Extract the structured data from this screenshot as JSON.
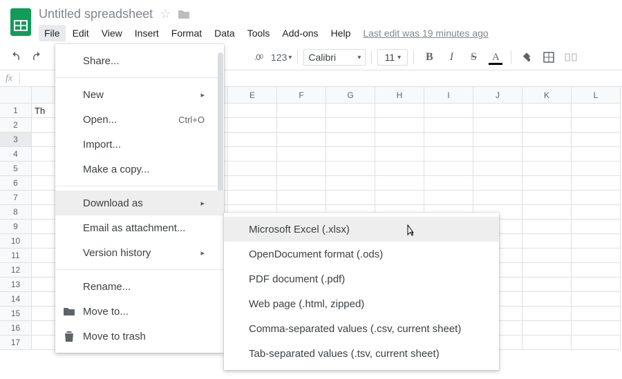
{
  "header": {
    "doc_title": "Untitled spreadsheet",
    "last_edit": "Last edit was 19 minutes ago",
    "menubar": [
      "File",
      "Edit",
      "View",
      "Insert",
      "Format",
      "Data",
      "Tools",
      "Add-ons",
      "Help"
    ],
    "open_menu": "File"
  },
  "toolbar": {
    "decimal_btn": ".0",
    "rounding_btn": ".00",
    "format_more": "123",
    "font_name": "Calibri",
    "font_size": "11",
    "bold": "B",
    "italic": "I",
    "strike": "S",
    "textcolor": "A"
  },
  "fx": {
    "label": "fx"
  },
  "grid": {
    "columns": [
      "",
      "",
      "",
      "",
      "E",
      "F",
      "G",
      "H",
      "I",
      "J",
      "K",
      "L"
    ],
    "row_count": 17,
    "selected_row": 3,
    "a1_value": "Th"
  },
  "file_menu": {
    "items": [
      {
        "label": "Share...",
        "type": "item"
      },
      {
        "type": "sep"
      },
      {
        "label": "New",
        "type": "sub"
      },
      {
        "label": "Open...",
        "shortcut": "Ctrl+O",
        "type": "item"
      },
      {
        "label": "Import...",
        "type": "item"
      },
      {
        "label": "Make a copy...",
        "type": "item"
      },
      {
        "type": "sep"
      },
      {
        "label": "Download as",
        "type": "sub",
        "hl": true
      },
      {
        "label": "Email as attachment...",
        "type": "item"
      },
      {
        "label": "Version history",
        "type": "sub"
      },
      {
        "type": "sep"
      },
      {
        "label": "Rename...",
        "type": "item"
      },
      {
        "label": "Move to...",
        "type": "item",
        "icon": "folder"
      },
      {
        "label": "Move to trash",
        "type": "item",
        "icon": "trash"
      }
    ]
  },
  "download_submenu": {
    "items": [
      {
        "label": "Microsoft Excel (.xlsx)",
        "hl": true
      },
      {
        "label": "OpenDocument format (.ods)"
      },
      {
        "label": "PDF document (.pdf)"
      },
      {
        "label": "Web page (.html, zipped)"
      },
      {
        "label": "Comma-separated values (.csv, current sheet)"
      },
      {
        "label": "Tab-separated values (.tsv, current sheet)"
      }
    ]
  }
}
